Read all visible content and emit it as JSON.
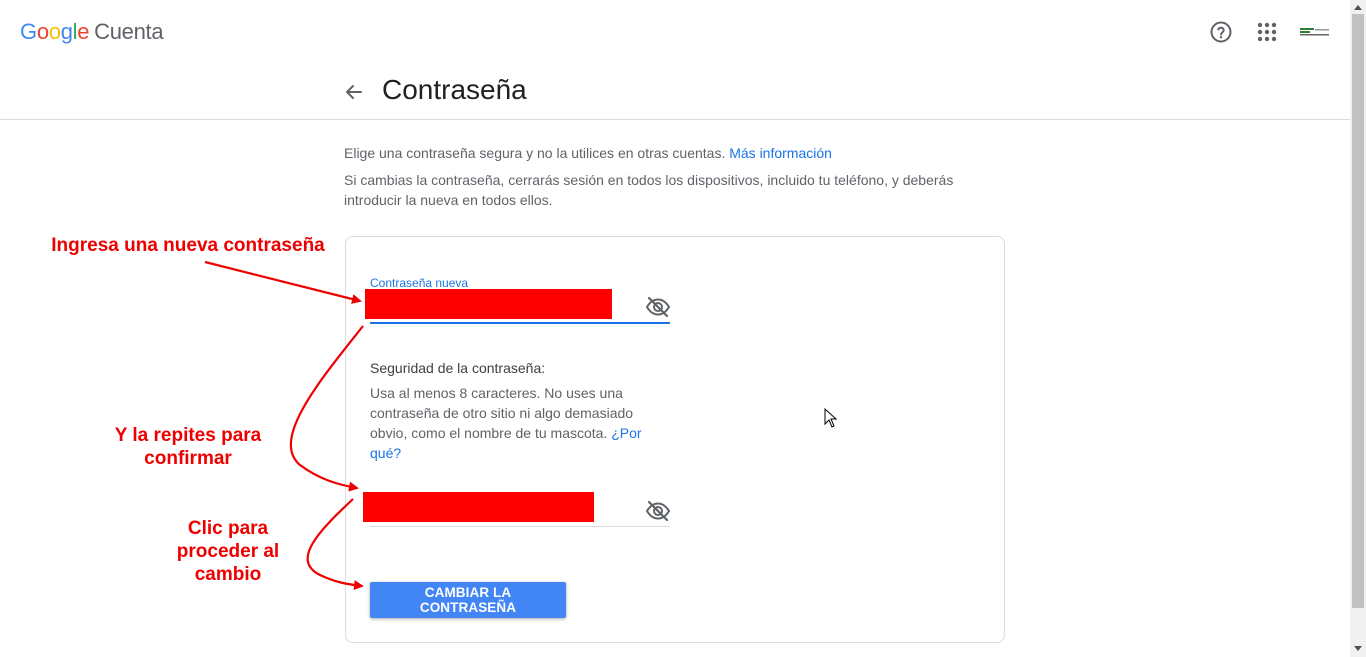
{
  "header": {
    "logo_brand": "Google",
    "logo_product": "Cuenta"
  },
  "page": {
    "title": "Contraseña"
  },
  "intro": {
    "line1": "Elige una contraseña segura y no la utilices en otras cuentas.",
    "line1_link": "Más información",
    "line2": "Si cambias la contraseña, cerrarás sesión en todos los dispositivos, incluido tu teléfono, y deberás introducir la nueva en todos ellos."
  },
  "form": {
    "new_password_label": "Contraseña nueva",
    "strength_heading": "Seguridad de la contraseña:",
    "strength_text": "Usa al menos 8 caracteres. No uses una contraseña de otro sitio ni algo demasiado obvio, como el nombre de tu mascota.",
    "strength_link": "¿Por qué?",
    "submit_label": "CAMBIAR LA CONTRASEÑA"
  },
  "annotations": {
    "a1": "Ingresa una nueva contraseña",
    "a2_line1": "Y la repites para",
    "a2_line2": "confirmar",
    "a3_line1": "Clic para",
    "a3_line2": "proceder al",
    "a3_line3": "cambio",
    "color": "#ee0000"
  },
  "icons": {
    "help": "help-circle-icon",
    "apps": "apps-grid-icon",
    "back": "arrow-back-icon",
    "visibility": "eye-off-icon"
  },
  "colors": {
    "accent": "#1a73e8",
    "button": "#4285f4",
    "redaction": "#ff0000"
  }
}
